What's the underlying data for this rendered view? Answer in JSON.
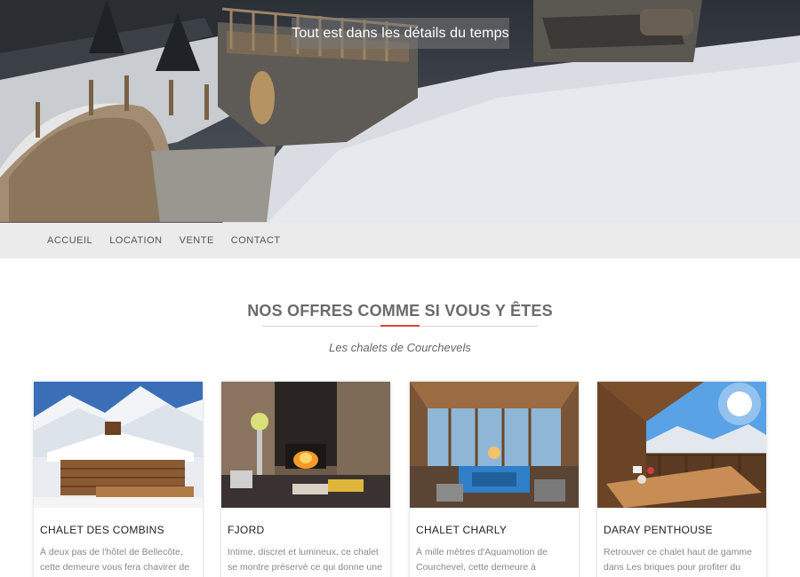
{
  "hero": {
    "tagline": "Tout est dans les détails du temps"
  },
  "nav": {
    "items": [
      "ACCUEIL",
      "LOCATION",
      "VENTE",
      "CONTACT"
    ]
  },
  "section": {
    "title": "NOS OFFRES COMME SI VOUS Y ÊTES",
    "subtitle": "Les chalets de Courchevels"
  },
  "cards": [
    {
      "title": "CHALET DES COMBINS",
      "text": "À deux pas de l'hôtel de Bellecôte, cette demeure vous fera chavirer de"
    },
    {
      "title": "FJORD",
      "text": "Intime, discret et lumineux, ce chalet se montre préservé ce qui donne une"
    },
    {
      "title": "CHALET CHARLY",
      "text": "À mille mètres d'Aquamotion de Courchevel, cette demeure à caractère"
    },
    {
      "title": "DARAY PENTHOUSE",
      "text": "Retrouver ce chalet haut de gamme dans Les briques pour profiter du lever"
    }
  ],
  "colors": {
    "accent": "#e0452f",
    "nav_bg": "#ebebeb"
  }
}
